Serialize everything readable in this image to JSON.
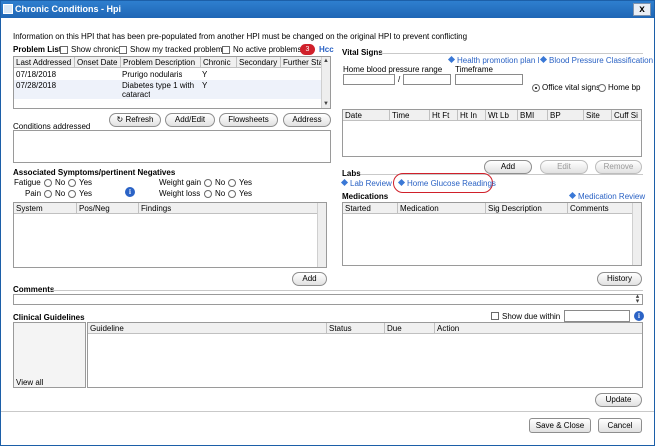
{
  "window": {
    "title": "Chronic Conditions - Hpi",
    "close_label": "x"
  },
  "info_message": "Information on this HPI that has been pre-populated from another HPI must be changed on the original HPI to prevent conflicting",
  "problem_list": {
    "title": "Problem List",
    "show_chronic": "Show chronic",
    "show_tracked": "Show my tracked problems",
    "no_active": "No active problems",
    "badge": "3",
    "link_partial": "Hcc",
    "columns": [
      "Last Addressed",
      "Onset Date",
      "Problem Description",
      "Chronic",
      "Secondary",
      "Further Stat"
    ],
    "rows": [
      {
        "last": "07/18/2018",
        "onset": "",
        "desc": "Prurigo nodularis",
        "chronic": "Y",
        "secondary": ""
      },
      {
        "last": "07/28/2018",
        "onset": "",
        "desc": "Diabetes type 1 with",
        "desc2": "cataract",
        "chronic": "Y",
        "secondary": ""
      }
    ],
    "buttons": {
      "refresh": "Refresh",
      "add_edit": "Add/Edit",
      "flowsheets": "Flowsheets",
      "address": "Address"
    }
  },
  "conditions_addressed": {
    "label": "Conditions addressed"
  },
  "associated": {
    "title": "Associated Symptoms/pertinent Negatives",
    "no": "No",
    "yes": "Yes",
    "items": {
      "fatigue": "Fatigue",
      "pain": "Pain",
      "weight_gain": "Weight gain",
      "weight_loss": "Weight loss"
    },
    "columns": [
      "System",
      "Pos/Neg",
      "Findings"
    ],
    "add_button": "Add"
  },
  "vital_signs": {
    "title": "Vital Signs",
    "health_link": "Health promotion plan l",
    "bp_link": "Blood Pressure Classification",
    "home_bp_range": "Home blood pressure range",
    "slash": "/",
    "timeframe": "Timeframe",
    "office_vitals": "Office vital signs",
    "home_bp": "Home bp",
    "columns": [
      "Date",
      "Time",
      "Ht Ft",
      "Ht In",
      "Wt Lb",
      "BMI",
      "BP",
      "Site",
      "Cuff Si"
    ],
    "buttons": {
      "add": "Add",
      "edit": "Edit",
      "remove": "Remove"
    }
  },
  "labs": {
    "title": "Labs",
    "lab_review": "Lab Review",
    "home_glucose": "Home Glucose Readings"
  },
  "medications": {
    "title": "Medications",
    "review_link": "Medication Review",
    "columns": [
      "Started",
      "Medication",
      "Sig Description",
      "Comments"
    ],
    "history_button": "History"
  },
  "comments": {
    "title": "Comments"
  },
  "clinical_guidelines": {
    "title": "Clinical Guidelines",
    "show_due": "Show due within",
    "view_all": "View all",
    "columns": [
      "Guideline",
      "Status",
      "Due",
      "Action"
    ],
    "update_button": "Update"
  },
  "footer": {
    "save_close": "Save & Close",
    "cancel": "Cancel"
  },
  "colors": {
    "titlebar": "#1f66b5",
    "link": "#2a62c4",
    "highlight_circle": "#d0202a",
    "badge": "#d0202a"
  }
}
